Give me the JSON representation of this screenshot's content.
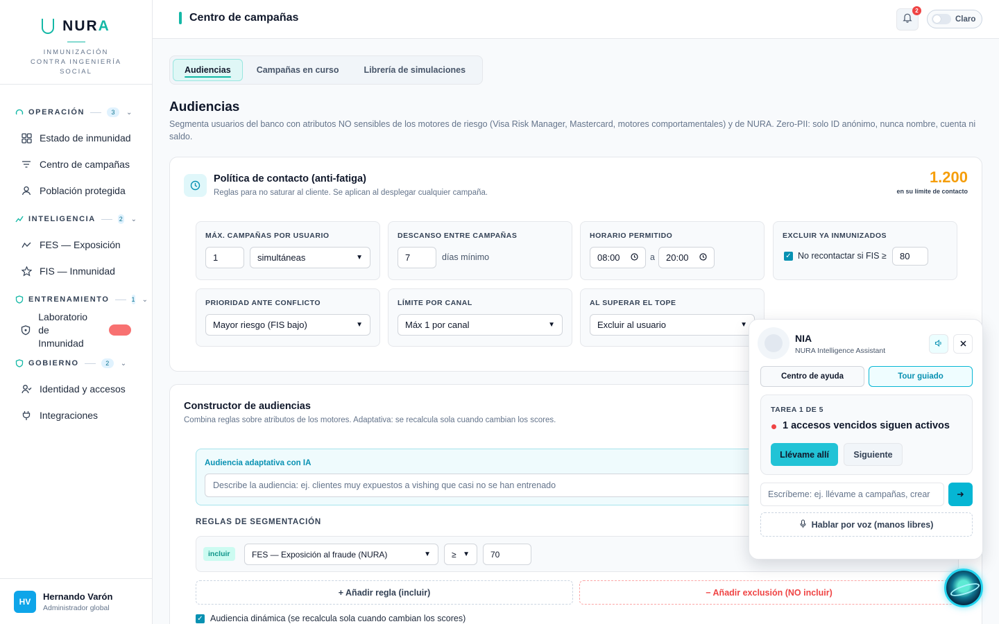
{
  "brand": {
    "name_main": "NUR",
    "name_accent": "A",
    "tagline": "INMUNIZACIÓN CONTRA INGENIERÍA SOCIAL"
  },
  "sidebar": {
    "sections": [
      {
        "title": "OPERACIÓN",
        "count": "3",
        "icon": "gauge-icon",
        "items": [
          {
            "label": "Estado de inmunidad",
            "icon": "grid-icon"
          },
          {
            "label": "Centro de campañas",
            "icon": "filter-icon"
          },
          {
            "label": "Población protegida",
            "icon": "user-icon"
          }
        ]
      },
      {
        "title": "INTELIGENCIA",
        "count": "2",
        "icon": "trend-icon",
        "items": [
          {
            "label": "FES — Exposición",
            "icon": "activity-icon"
          },
          {
            "label": "FIS — Inmunidad",
            "icon": "star-icon"
          }
        ]
      },
      {
        "title": "ENTRENAMIENTO",
        "count": "1",
        "icon": "shield-icon",
        "items": [
          {
            "label_line1": "Laboratorio",
            "label_line2": "de Inmunidad",
            "icon": "shield-icon"
          }
        ]
      },
      {
        "title": "GOBIERNO",
        "count": "2",
        "icon": "shield-icon",
        "items": [
          {
            "label": "Identidad y accesos",
            "icon": "user-check-icon"
          },
          {
            "label": "Integraciones",
            "icon": "plug-icon"
          }
        ]
      }
    ]
  },
  "user": {
    "initials": "HV",
    "name": "Hernando Varón",
    "role": "Administrador global"
  },
  "topbar": {
    "title": "Centro de campañas",
    "notifications": "2",
    "theme_label": "Claro"
  },
  "tabs": [
    "Audiencias",
    "Campañas en curso",
    "Librería de simulaciones"
  ],
  "page": {
    "title": "Audiencias",
    "description": "Segmenta usuarios del banco con atributos NO sensibles de los motores de riesgo (Visa Risk Manager, Mastercard, motores comportamentales) y de NURA. Zero-PII: solo ID anónimo, nunca nombre, cuenta ni saldo."
  },
  "policy": {
    "title": "Política de contacto (anti-fatiga)",
    "subtitle": "Reglas para no saturar al cliente. Se aplican al desplegar cualquier campaña.",
    "count": "1.200",
    "count_label": "en su límite de contacto",
    "max_campaigns": {
      "label": "MÁX. CAMPAÑAS POR USUARIO",
      "value": "1",
      "mode": "simultáneas"
    },
    "rest": {
      "label": "DESCANSO ENTRE CAMPAÑAS",
      "value": "7",
      "unit": "días mínimo"
    },
    "schedule": {
      "label": "HORARIO PERMITIDO",
      "from": "08:00",
      "sep": "a",
      "to": "20:00"
    },
    "exclude": {
      "label": "EXCLUIR YA INMUNIZADOS",
      "check_label": "No recontactar si FIS ≥",
      "value": "80"
    },
    "priority": {
      "label": "PRIORIDAD ANTE CONFLICTO",
      "value": "Mayor riesgo (FIS bajo)"
    },
    "channel_limit": {
      "label": "LÍMITE POR CANAL",
      "value": "Máx 1 por canal"
    },
    "over_limit": {
      "label": "AL SUPERAR EL TOPE",
      "value": "Excluir al usuario"
    }
  },
  "builder": {
    "title": "Constructor de audiencias",
    "subtitle": "Combina reglas sobre atributos de los motores. Adaptativa: se recalcula sola cuando cambian los scores.",
    "ai_label": "Audiencia adaptativa con IA",
    "ai_placeholder": "Describe la audiencia: ej. clientes muy expuestos a vishing que casi no se han entrenado",
    "rules_title": "REGLAS DE SEGMENTACIÓN",
    "rule": {
      "mode": "incluir",
      "attribute": "FES — Exposición al fraude (NURA)",
      "operator": "≥",
      "value": "70"
    },
    "add_rule": "+ Añadir regla (incluir)",
    "add_exclusion": "− Añadir exclusión (NO incluir)",
    "dynamic_label": "Audiencia dinámica (se recalcula sola cuando cambian los scores)"
  },
  "nia": {
    "name": "NIA",
    "subtitle": "NURA Intelligence Assistant",
    "tab_help": "Centro de ayuda",
    "tab_tour": "Tour guiado",
    "task_label": "TAREA 1 DE 5",
    "task_title": "1 accesos vencidos siguen activos",
    "goto": "Llévame allí",
    "next": "Siguiente",
    "input_placeholder": "Escríbeme: ej. llévame a campañas, crear",
    "voice": "Hablar por voz (manos libres)"
  },
  "colors": {
    "accent": "#14b8a6",
    "cyan": "#06b6d4",
    "warning": "#f59e0b",
    "danger": "#ef4444"
  }
}
